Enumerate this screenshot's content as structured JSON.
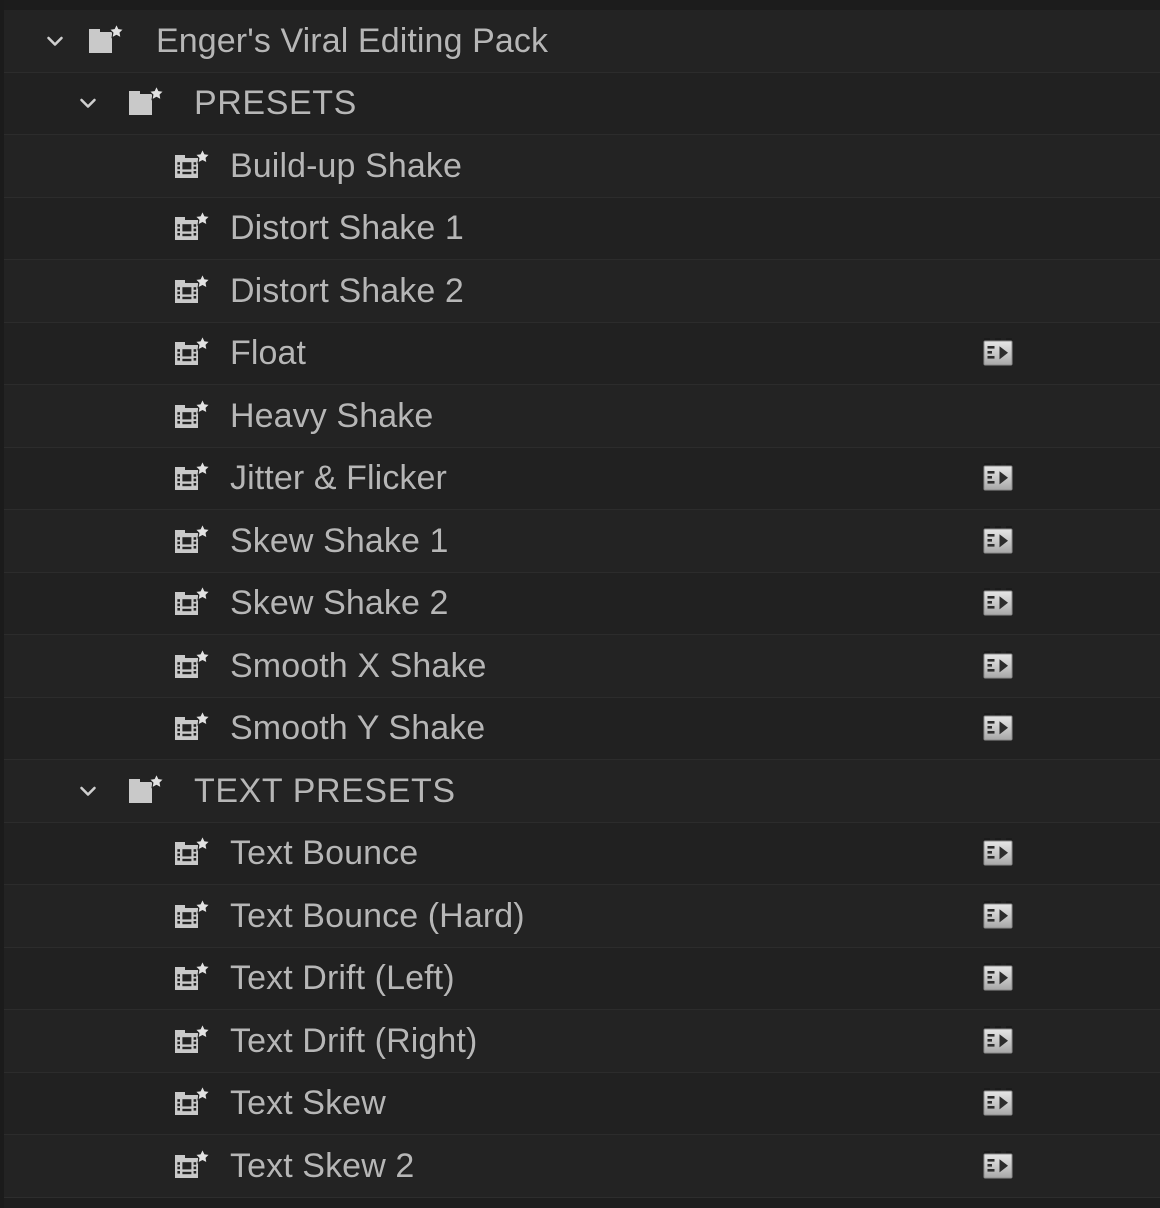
{
  "panel": {
    "name": "effects-tree-panel",
    "background_color": "#232323",
    "row_background_alt_color": "#212121",
    "separator_color": "#2c2c2c",
    "label_color": "#b6b6b6",
    "icon_color": "#c9c9c9"
  },
  "tree": {
    "rows": [
      {
        "label": "Enger's Viral Editing Pack",
        "depth": 0,
        "kind": "folder",
        "expander": "chevron-down",
        "expanded": true,
        "icon": "folder-star-icon",
        "has_mogrt": false
      },
      {
        "label": "PRESETS",
        "depth": 1,
        "kind": "folder",
        "expander": "chevron-down",
        "expanded": true,
        "icon": "folder-star-icon",
        "has_mogrt": false
      },
      {
        "label": "Build-up Shake",
        "depth": 2,
        "kind": "preset",
        "expander": "none",
        "expanded": false,
        "icon": "preset-folder-star-icon",
        "has_mogrt": false
      },
      {
        "label": "Distort Shake 1",
        "depth": 2,
        "kind": "preset",
        "expander": "none",
        "expanded": false,
        "icon": "preset-folder-star-icon",
        "has_mogrt": false
      },
      {
        "label": "Distort Shake 2",
        "depth": 2,
        "kind": "preset",
        "expander": "none",
        "expanded": false,
        "icon": "preset-folder-star-icon",
        "has_mogrt": false
      },
      {
        "label": "Float",
        "depth": 2,
        "kind": "preset",
        "expander": "none",
        "expanded": false,
        "icon": "preset-folder-star-icon",
        "has_mogrt": true
      },
      {
        "label": "Heavy Shake",
        "depth": 2,
        "kind": "preset",
        "expander": "none",
        "expanded": false,
        "icon": "preset-folder-star-icon",
        "has_mogrt": false
      },
      {
        "label": "Jitter & Flicker",
        "depth": 2,
        "kind": "preset",
        "expander": "none",
        "expanded": false,
        "icon": "preset-folder-star-icon",
        "has_mogrt": true
      },
      {
        "label": "Skew Shake 1",
        "depth": 2,
        "kind": "preset",
        "expander": "none",
        "expanded": false,
        "icon": "preset-folder-star-icon",
        "has_mogrt": true
      },
      {
        "label": "Skew Shake 2",
        "depth": 2,
        "kind": "preset",
        "expander": "none",
        "expanded": false,
        "icon": "preset-folder-star-icon",
        "has_mogrt": true
      },
      {
        "label": "Smooth X Shake",
        "depth": 2,
        "kind": "preset",
        "expander": "none",
        "expanded": false,
        "icon": "preset-folder-star-icon",
        "has_mogrt": true
      },
      {
        "label": "Smooth Y Shake",
        "depth": 2,
        "kind": "preset",
        "expander": "none",
        "expanded": false,
        "icon": "preset-folder-star-icon",
        "has_mogrt": true
      },
      {
        "label": "TEXT PRESETS",
        "depth": 1,
        "kind": "folder",
        "expander": "chevron-down",
        "expanded": true,
        "icon": "folder-star-icon",
        "has_mogrt": false
      },
      {
        "label": "Text Bounce",
        "depth": 2,
        "kind": "preset",
        "expander": "none",
        "expanded": false,
        "icon": "preset-folder-star-icon",
        "has_mogrt": true
      },
      {
        "label": "Text Bounce (Hard)",
        "depth": 2,
        "kind": "preset",
        "expander": "none",
        "expanded": false,
        "icon": "preset-folder-star-icon",
        "has_mogrt": true
      },
      {
        "label": "Text Drift (Left)",
        "depth": 2,
        "kind": "preset",
        "expander": "none",
        "expanded": false,
        "icon": "preset-folder-star-icon",
        "has_mogrt": true
      },
      {
        "label": "Text Drift (Right)",
        "depth": 2,
        "kind": "preset",
        "expander": "none",
        "expanded": false,
        "icon": "preset-folder-star-icon",
        "has_mogrt": true
      },
      {
        "label": "Text Skew",
        "depth": 2,
        "kind": "preset",
        "expander": "none",
        "expanded": false,
        "icon": "preset-folder-star-icon",
        "has_mogrt": true
      },
      {
        "label": "Text Skew 2",
        "depth": 2,
        "kind": "preset",
        "expander": "none",
        "expanded": false,
        "icon": "preset-folder-star-icon",
        "has_mogrt": true
      }
    ]
  }
}
